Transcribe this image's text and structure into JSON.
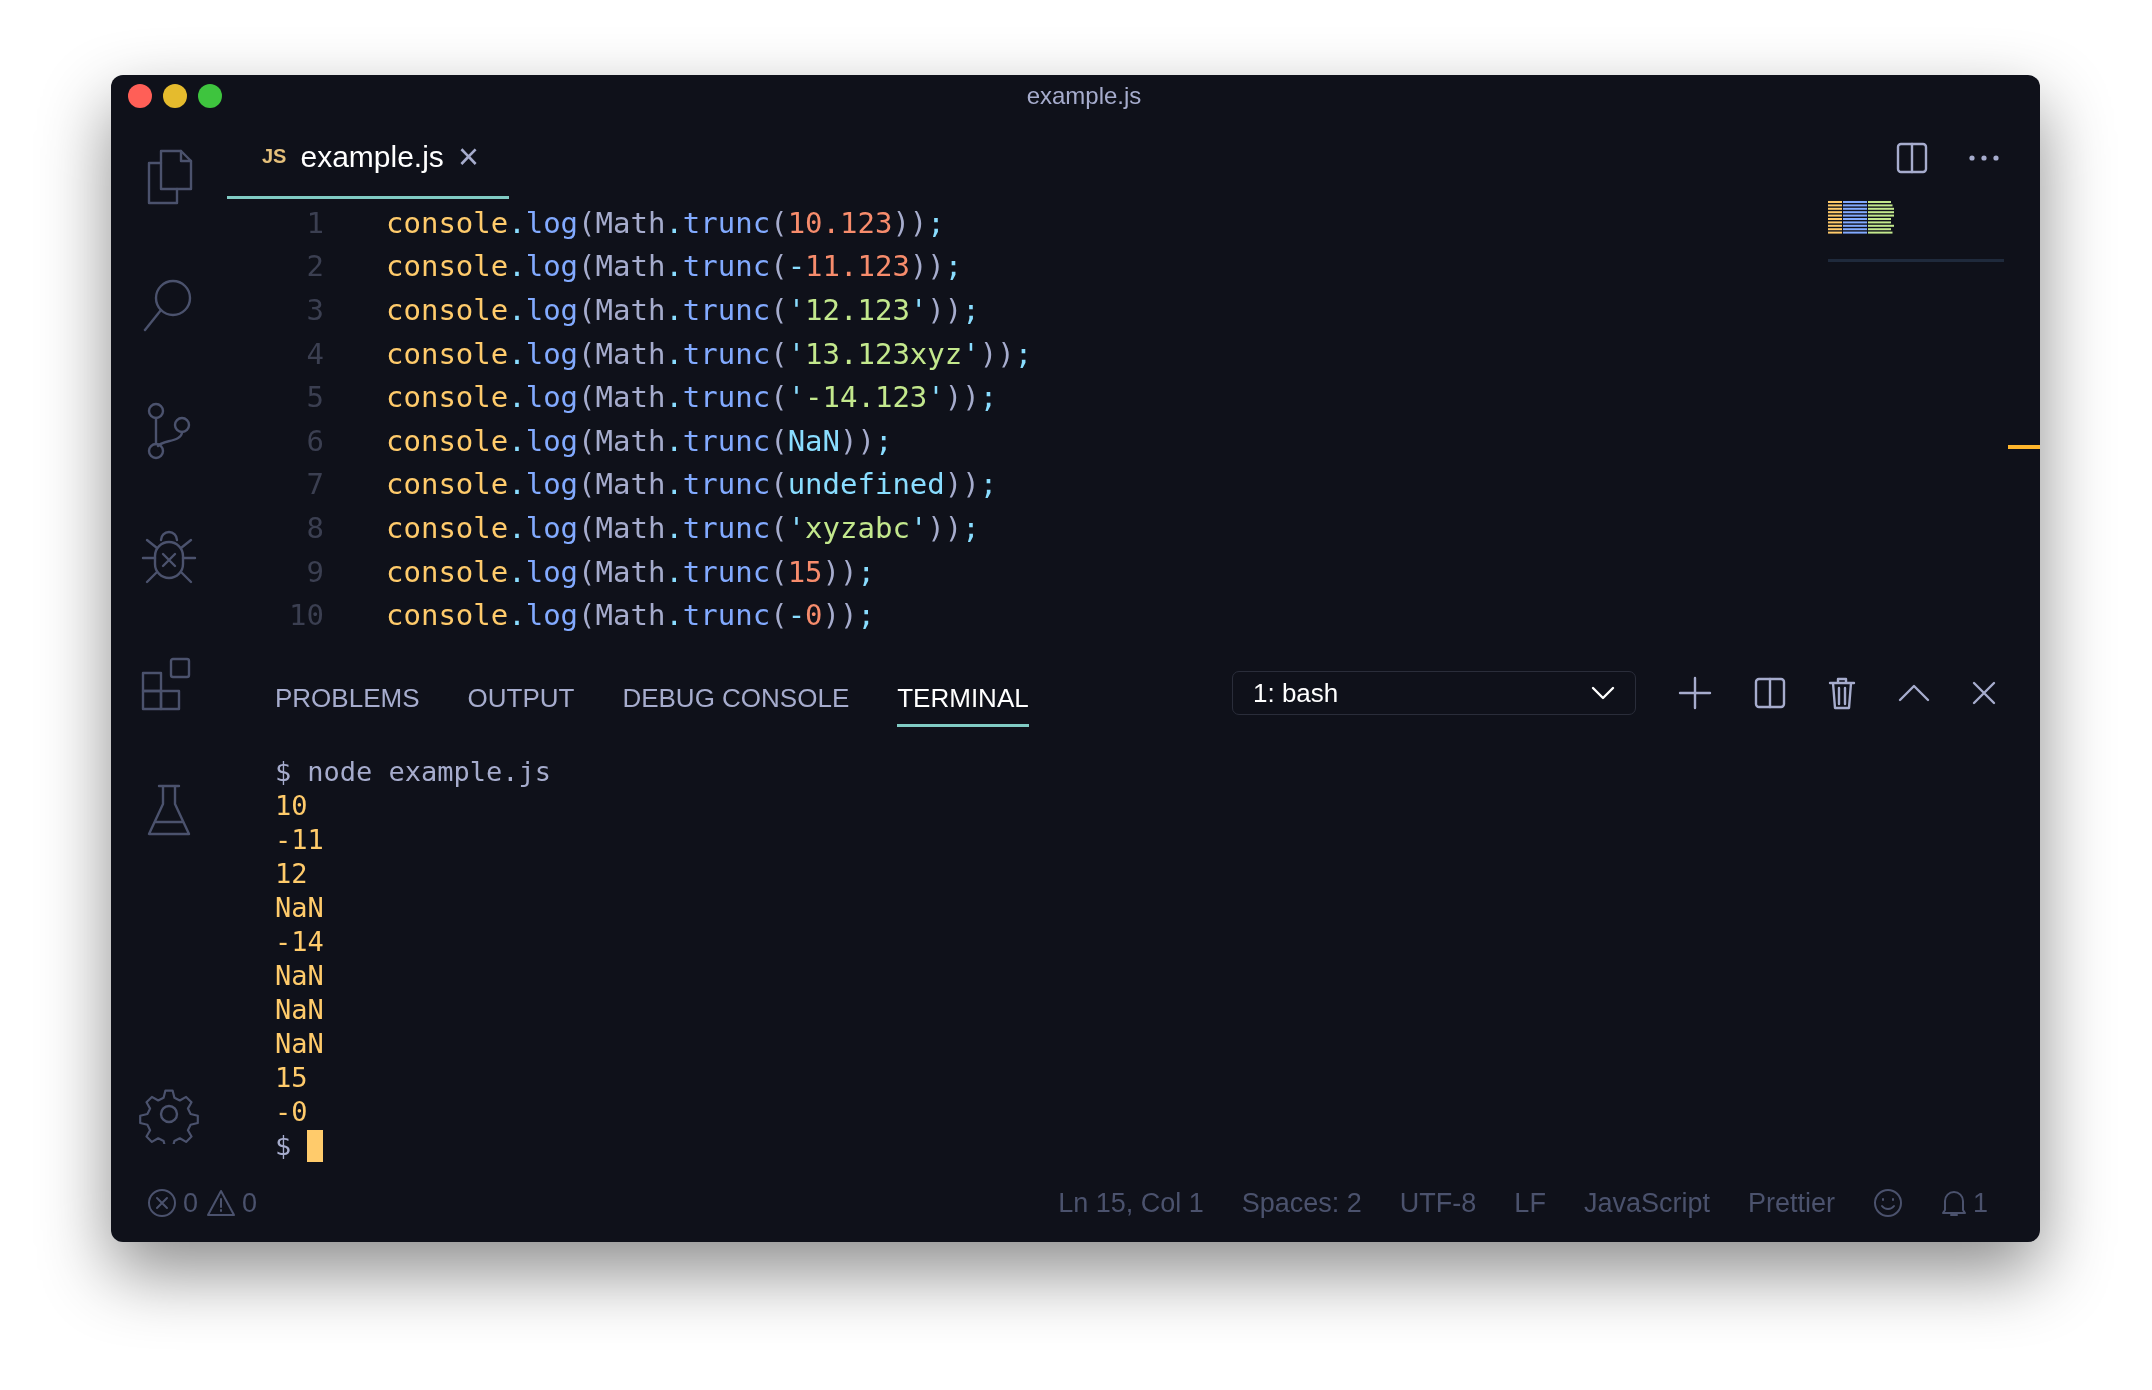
{
  "window": {
    "title": "example.js"
  },
  "editor_tabs": [
    {
      "badge": "JS",
      "label": "example.js",
      "close": "×",
      "selected": true
    }
  ],
  "code_lines": [
    {
      "number": "1",
      "tokens": [
        {
          "kind": "obj",
          "text": "console"
        },
        {
          "kind": "punct",
          "text": "."
        },
        {
          "kind": "method",
          "text": "log"
        },
        {
          "kind": "plain",
          "text": "(Math"
        },
        {
          "kind": "punct",
          "text": "."
        },
        {
          "kind": "method",
          "text": "trunc"
        },
        {
          "kind": "plain",
          "text": "("
        },
        {
          "kind": "number",
          "text": "10.123"
        },
        {
          "kind": "plain",
          "text": "))"
        },
        {
          "kind": "punct",
          "text": ";"
        }
      ]
    },
    {
      "number": "2",
      "tokens": [
        {
          "kind": "obj",
          "text": "console"
        },
        {
          "kind": "punct",
          "text": "."
        },
        {
          "kind": "method",
          "text": "log"
        },
        {
          "kind": "plain",
          "text": "(Math"
        },
        {
          "kind": "punct",
          "text": "."
        },
        {
          "kind": "method",
          "text": "trunc"
        },
        {
          "kind": "plain",
          "text": "("
        },
        {
          "kind": "punct",
          "text": "-"
        },
        {
          "kind": "number",
          "text": "11.123"
        },
        {
          "kind": "plain",
          "text": "))"
        },
        {
          "kind": "punct",
          "text": ";"
        }
      ]
    },
    {
      "number": "3",
      "tokens": [
        {
          "kind": "obj",
          "text": "console"
        },
        {
          "kind": "punct",
          "text": "."
        },
        {
          "kind": "method",
          "text": "log"
        },
        {
          "kind": "plain",
          "text": "(Math"
        },
        {
          "kind": "punct",
          "text": "."
        },
        {
          "kind": "method",
          "text": "trunc"
        },
        {
          "kind": "plain",
          "text": "("
        },
        {
          "kind": "punct",
          "text": "'"
        },
        {
          "kind": "string",
          "text": "12.123"
        },
        {
          "kind": "punct",
          "text": "'"
        },
        {
          "kind": "plain",
          "text": "))"
        },
        {
          "kind": "punct",
          "text": ";"
        }
      ]
    },
    {
      "number": "4",
      "tokens": [
        {
          "kind": "obj",
          "text": "console"
        },
        {
          "kind": "punct",
          "text": "."
        },
        {
          "kind": "method",
          "text": "log"
        },
        {
          "kind": "plain",
          "text": "(Math"
        },
        {
          "kind": "punct",
          "text": "."
        },
        {
          "kind": "method",
          "text": "trunc"
        },
        {
          "kind": "plain",
          "text": "("
        },
        {
          "kind": "punct",
          "text": "'"
        },
        {
          "kind": "string",
          "text": "13.123xyz"
        },
        {
          "kind": "punct",
          "text": "'"
        },
        {
          "kind": "plain",
          "text": "))"
        },
        {
          "kind": "punct",
          "text": ";"
        }
      ]
    },
    {
      "number": "5",
      "tokens": [
        {
          "kind": "obj",
          "text": "console"
        },
        {
          "kind": "punct",
          "text": "."
        },
        {
          "kind": "method",
          "text": "log"
        },
        {
          "kind": "plain",
          "text": "(Math"
        },
        {
          "kind": "punct",
          "text": "."
        },
        {
          "kind": "method",
          "text": "trunc"
        },
        {
          "kind": "plain",
          "text": "("
        },
        {
          "kind": "punct",
          "text": "'"
        },
        {
          "kind": "string",
          "text": "-14.123"
        },
        {
          "kind": "punct",
          "text": "'"
        },
        {
          "kind": "plain",
          "text": "))"
        },
        {
          "kind": "punct",
          "text": ";"
        }
      ]
    },
    {
      "number": "6",
      "tokens": [
        {
          "kind": "obj",
          "text": "console"
        },
        {
          "kind": "punct",
          "text": "."
        },
        {
          "kind": "method",
          "text": "log"
        },
        {
          "kind": "plain",
          "text": "(Math"
        },
        {
          "kind": "punct",
          "text": "."
        },
        {
          "kind": "method",
          "text": "trunc"
        },
        {
          "kind": "plain",
          "text": "("
        },
        {
          "kind": "const",
          "text": "NaN"
        },
        {
          "kind": "plain",
          "text": "))"
        },
        {
          "kind": "punct",
          "text": ";"
        }
      ]
    },
    {
      "number": "7",
      "tokens": [
        {
          "kind": "obj",
          "text": "console"
        },
        {
          "kind": "punct",
          "text": "."
        },
        {
          "kind": "method",
          "text": "log"
        },
        {
          "kind": "plain",
          "text": "(Math"
        },
        {
          "kind": "punct",
          "text": "."
        },
        {
          "kind": "method",
          "text": "trunc"
        },
        {
          "kind": "plain",
          "text": "("
        },
        {
          "kind": "const",
          "text": "undefined"
        },
        {
          "kind": "plain",
          "text": "))"
        },
        {
          "kind": "punct",
          "text": ";"
        }
      ]
    },
    {
      "number": "8",
      "tokens": [
        {
          "kind": "obj",
          "text": "console"
        },
        {
          "kind": "punct",
          "text": "."
        },
        {
          "kind": "method",
          "text": "log"
        },
        {
          "kind": "plain",
          "text": "(Math"
        },
        {
          "kind": "punct",
          "text": "."
        },
        {
          "kind": "method",
          "text": "trunc"
        },
        {
          "kind": "plain",
          "text": "("
        },
        {
          "kind": "punct",
          "text": "'"
        },
        {
          "kind": "string",
          "text": "xyzabc"
        },
        {
          "kind": "punct",
          "text": "'"
        },
        {
          "kind": "plain",
          "text": "))"
        },
        {
          "kind": "punct",
          "text": ";"
        }
      ]
    },
    {
      "number": "9",
      "tokens": [
        {
          "kind": "obj",
          "text": "console"
        },
        {
          "kind": "punct",
          "text": "."
        },
        {
          "kind": "method",
          "text": "log"
        },
        {
          "kind": "plain",
          "text": "(Math"
        },
        {
          "kind": "punct",
          "text": "."
        },
        {
          "kind": "method",
          "text": "trunc"
        },
        {
          "kind": "plain",
          "text": "("
        },
        {
          "kind": "number",
          "text": "15"
        },
        {
          "kind": "plain",
          "text": "))"
        },
        {
          "kind": "punct",
          "text": ";"
        }
      ]
    },
    {
      "number": "10",
      "tokens": [
        {
          "kind": "obj",
          "text": "console"
        },
        {
          "kind": "punct",
          "text": "."
        },
        {
          "kind": "method",
          "text": "log"
        },
        {
          "kind": "plain",
          "text": "(Math"
        },
        {
          "kind": "punct",
          "text": "."
        },
        {
          "kind": "method",
          "text": "trunc"
        },
        {
          "kind": "plain",
          "text": "("
        },
        {
          "kind": "punct",
          "text": "-"
        },
        {
          "kind": "number",
          "text": "0"
        },
        {
          "kind": "plain",
          "text": "))"
        },
        {
          "kind": "punct",
          "text": ";"
        }
      ]
    }
  ],
  "panel_tabs": [
    {
      "label": "PROBLEMS",
      "selected": false
    },
    {
      "label": "OUTPUT",
      "selected": false
    },
    {
      "label": "DEBUG CONSOLE",
      "selected": false
    },
    {
      "label": "TERMINAL",
      "selected": true
    }
  ],
  "terminal_select": {
    "value": "1: bash"
  },
  "terminal": {
    "prompt": "$",
    "command": "node example.js",
    "output": [
      "10",
      "-11",
      "12",
      "NaN",
      "-14",
      "NaN",
      "NaN",
      "NaN",
      "15",
      "-0"
    ]
  },
  "status_bar": {
    "errors": "0",
    "warnings": "0",
    "items": [
      "Ln 15, Col 1",
      "Spaces: 2",
      "UTF-8",
      "LF",
      "JavaScript",
      "Prettier"
    ],
    "notifications": "1"
  }
}
